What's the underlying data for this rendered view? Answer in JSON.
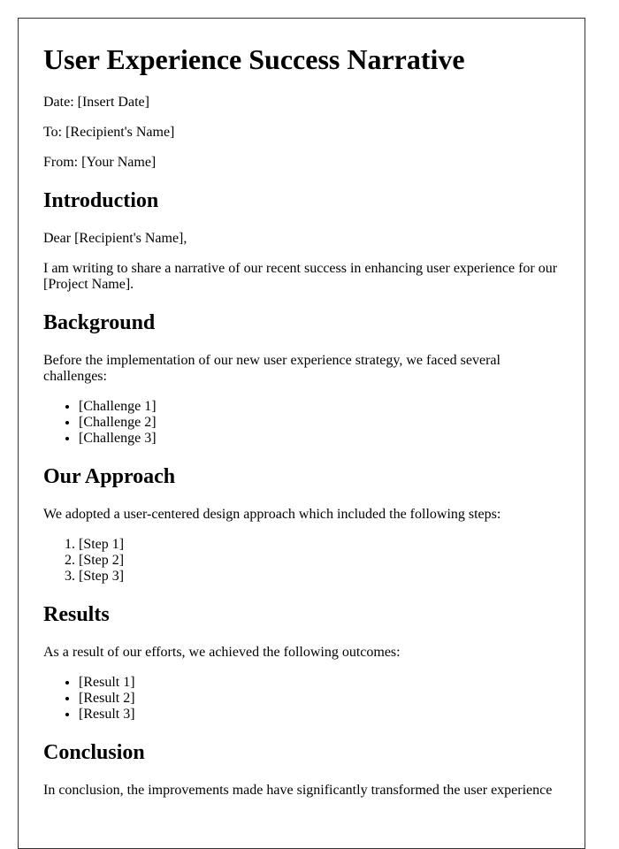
{
  "title": "User Experience Success Narrative",
  "header": {
    "date": "Date: [Insert Date]",
    "to": "To: [Recipient's Name]",
    "from": "From: [Your Name]"
  },
  "sections": {
    "introduction": {
      "heading": "Introduction",
      "salutation": "Dear [Recipient's Name],",
      "paragraph": "I am writing to share a narrative of our recent success in enhancing user experience for our [Project Name]."
    },
    "background": {
      "heading": "Background",
      "paragraph": "Before the implementation of our new user experience strategy, we faced several challenges:",
      "items": [
        "[Challenge 1]",
        "[Challenge 2]",
        "[Challenge 3]"
      ]
    },
    "approach": {
      "heading": "Our Approach",
      "paragraph": "We adopted a user-centered design approach which included the following steps:",
      "items": [
        "[Step 1]",
        "[Step 2]",
        "[Step 3]"
      ]
    },
    "results": {
      "heading": "Results",
      "paragraph": "As a result of our efforts, we achieved the following outcomes:",
      "items": [
        "[Result 1]",
        "[Result 2]",
        "[Result 3]"
      ]
    },
    "conclusion": {
      "heading": "Conclusion",
      "paragraph": "In conclusion, the improvements made have significantly transformed the user experience"
    }
  },
  "colors": {
    "border": "#333333",
    "text": "#000000",
    "background": "#ffffff"
  }
}
